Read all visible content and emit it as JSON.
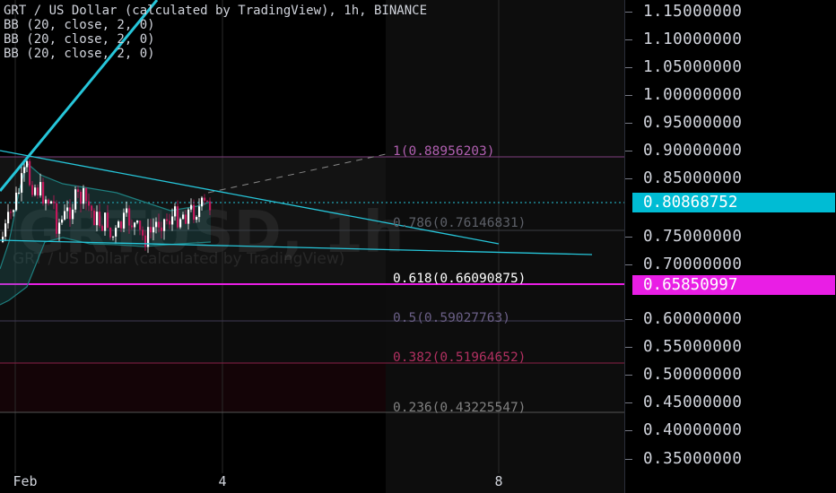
{
  "legend": {
    "title": "GRT / US Dollar (calculated by TradingView), 1h, BINANCE",
    "indicators": [
      "BB (20, close, 2, 0)",
      "BB (20, close, 2, 0)",
      "BB (20, close, 2, 0)"
    ]
  },
  "watermark": {
    "symbol": "GRTUSD, 1h",
    "description": "GRT / US Dollar (calculated by TradingView)"
  },
  "price_scale": {
    "labels": [
      "1.15000000",
      "1.10000000",
      "1.05000000",
      "1.00000000",
      "0.95000000",
      "0.90000000",
      "0.85000000",
      "0.75000000",
      "0.70000000",
      "0.60000000",
      "0.55000000",
      "0.50000000",
      "0.45000000",
      "0.40000000",
      "0.35000000"
    ],
    "current_price": "0.80868752",
    "current_price_color": "#00bcd4",
    "marked_price": "0.65850997",
    "marked_price_color": "#e91ee5"
  },
  "time_scale": {
    "labels": [
      "Feb",
      "4",
      "8"
    ]
  },
  "fib_levels": [
    {
      "label": "1(0.88956203)",
      "color": "#b05fb0"
    },
    {
      "label": "0.786(0.76146831)",
      "color": "#5d6068"
    },
    {
      "label": "0.618(0.66090875)",
      "color": "#ffffff"
    },
    {
      "label": "0.5(0.59027763)",
      "color": "#6a5f86"
    },
    {
      "label": "0.382(0.51964652)",
      "color": "#b03060"
    },
    {
      "label": "0.236(0.43225547)",
      "color": "#808080"
    }
  ],
  "colors": {
    "trendline": "#26c6da",
    "bollinger": "#1e7f7f",
    "candle_up": "#ffffff",
    "candle_down": "#c2185b"
  }
}
